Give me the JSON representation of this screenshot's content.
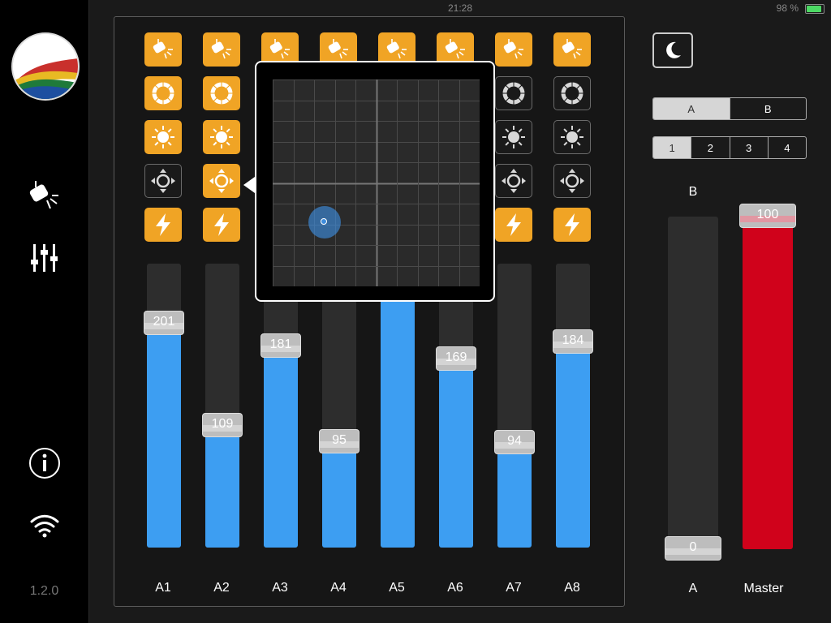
{
  "status": {
    "time": "21:28",
    "battery": "98 %",
    "battery_level": 0.98
  },
  "sidebar": {
    "version": "1.2.0",
    "icons": [
      "logo",
      "spotlight-icon",
      "mixer-icon",
      "info-icon",
      "wifi-icon"
    ]
  },
  "channels": [
    {
      "label": "A1",
      "value": 201,
      "buttons": [
        "on",
        "on",
        "on",
        "off",
        "on"
      ]
    },
    {
      "label": "A2",
      "value": 109,
      "buttons": [
        "on",
        "on",
        "on",
        "on",
        "on"
      ]
    },
    {
      "label": "A3",
      "value": 181,
      "buttons": [
        "on",
        "on",
        "on",
        "on",
        "on"
      ]
    },
    {
      "label": "A4",
      "value": 95,
      "buttons": [
        "on",
        "on",
        "on",
        "on",
        "on"
      ]
    },
    {
      "label": "A5",
      "value": 255,
      "buttons": [
        "on",
        "on",
        "on",
        "on",
        "on"
      ]
    },
    {
      "label": "A6",
      "value": 169,
      "buttons": [
        "on",
        "on",
        "on",
        "on",
        "on"
      ]
    },
    {
      "label": "A7",
      "value": 94,
      "buttons": [
        "on",
        "off",
        "off",
        "off",
        "on"
      ]
    },
    {
      "label": "A8",
      "value": 184,
      "buttons": [
        "on",
        "off",
        "off",
        "off",
        "on"
      ]
    }
  ],
  "fader_max": 255,
  "button_rows": [
    "spotlight-icon",
    "color-wheel-icon",
    "brightness-icon",
    "pan-tilt-icon",
    "strobe-icon"
  ],
  "popover": {
    "point_x": 0.25,
    "point_y": 0.69
  },
  "right": {
    "scene_tabs": [
      "A",
      "B"
    ],
    "scene_active": 0,
    "page_tabs": [
      "1",
      "2",
      "3",
      "4"
    ],
    "page_active": 0,
    "crossfade": {
      "top_label": "B",
      "bottom_label": "A",
      "value": "0"
    },
    "master": {
      "label": "Master",
      "value": "100"
    }
  },
  "colors": {
    "accent": "#f0a425",
    "fader": "#3d9ef2",
    "master": "#d0021b"
  }
}
